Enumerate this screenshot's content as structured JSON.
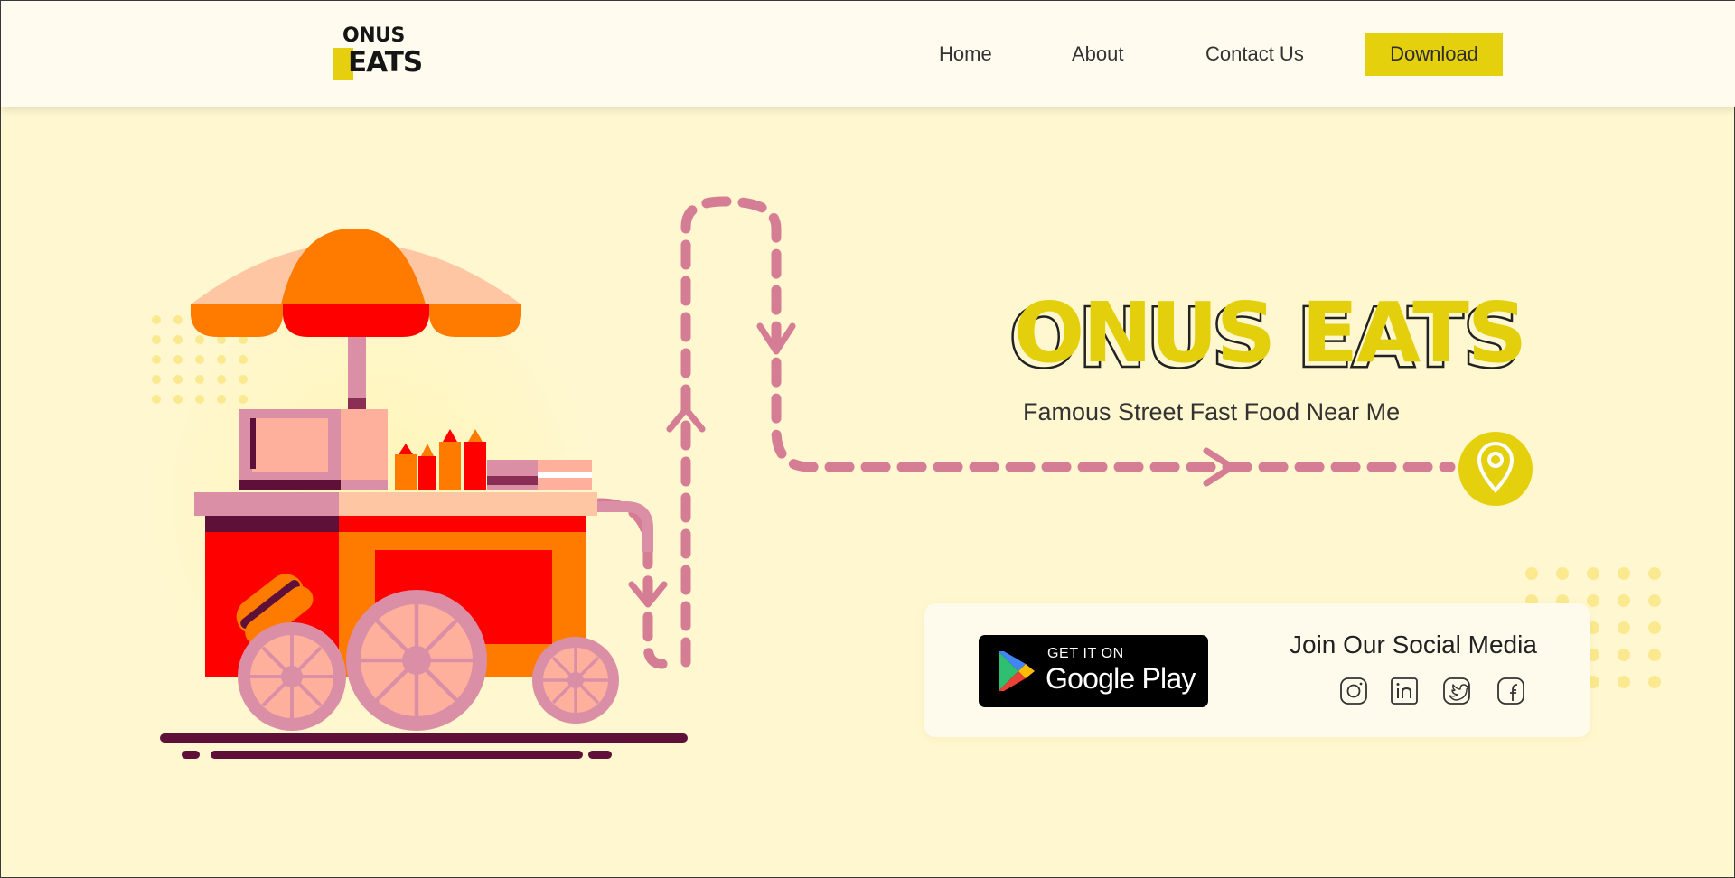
{
  "brand": {
    "logo_line1": "ONUS",
    "logo_line2": "EATS",
    "accent_color": "#e5d00e",
    "background_color": "#fff7cf"
  },
  "nav": {
    "items": [
      {
        "label": "Home"
      },
      {
        "label": "About"
      },
      {
        "label": "Contact Us"
      }
    ],
    "download_label": "Download"
  },
  "hero": {
    "title": "ONUS EATS",
    "subtitle": "Famous Street Fast Food Near Me",
    "location_icon": "location-pin-icon"
  },
  "store": {
    "get_it_on": "GET IT ON",
    "store_name": "Google Play"
  },
  "social": {
    "title": "Join Our Social Media",
    "icons": [
      "instagram-icon",
      "linkedin-icon",
      "twitter-icon",
      "facebook-icon"
    ]
  }
}
